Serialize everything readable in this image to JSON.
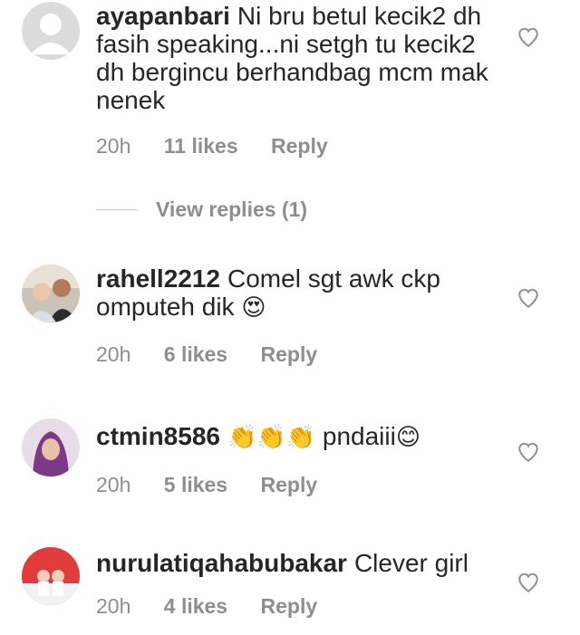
{
  "comments": [
    {
      "username": "ayapanbari",
      "text": "Ni bru betul kecik2 dh fasih speaking...ni setgh tu kecik2 dh bergincu berhandbag mcm mak nenek",
      "time": "20h",
      "likes": "11 likes",
      "reply": "Reply",
      "view_replies": "View replies (1)"
    },
    {
      "username": "rahell2212",
      "text": "Comel sgt awk ckp omputeh dik",
      "emoji": "😍",
      "time": "20h",
      "likes": "6 likes",
      "reply": "Reply"
    },
    {
      "username": "ctmin8586",
      "emoji_before": "👏👏👏",
      "text": "pndaiii",
      "emoji": "😊",
      "time": "20h",
      "likes": "5 likes",
      "reply": "Reply"
    },
    {
      "username": "nurulatiqahabubakar",
      "text": "Clever girl",
      "time": "20h",
      "likes": "4 likes",
      "reply": "Reply"
    }
  ],
  "colors": {
    "text": "#262626",
    "meta": "#8e8e8e",
    "heart": "#8e8e8e"
  },
  "icons": {
    "like": "heart-icon",
    "avatar_default": "default-avatar-icon"
  }
}
